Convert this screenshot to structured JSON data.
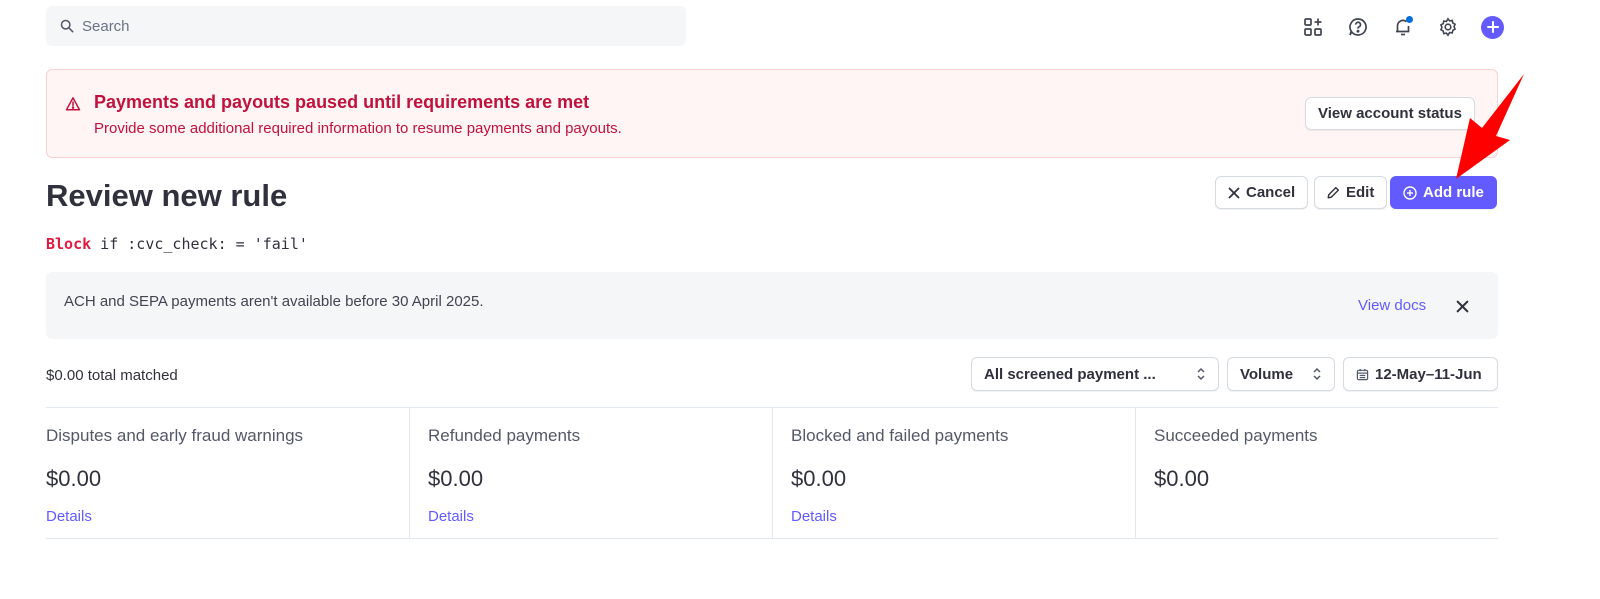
{
  "search": {
    "placeholder": "Search"
  },
  "top_icons": [
    "apps-icon",
    "help-icon",
    "bell-icon",
    "gear-icon",
    "plus-icon"
  ],
  "alert": {
    "title": "Payments and payouts paused until requirements are met",
    "description": "Provide some additional required information to resume payments and payouts.",
    "button_label": "View account status"
  },
  "header": {
    "title": "Review new rule",
    "cancel_label": "Cancel",
    "edit_label": "Edit",
    "add_label": "Add rule"
  },
  "rule": {
    "keyword": "Block",
    "condition": " if :cvc_check: = 'fail'"
  },
  "info": {
    "text": "ACH and SEPA payments aren't available before 30 April 2025.",
    "link_label": "View docs"
  },
  "filters": {
    "total": "$0.00 total matched",
    "payment_select": "All screened payment ...",
    "volume_select": "Volume",
    "date_range": "12-May–11-Jun"
  },
  "metrics": [
    {
      "label": "Disputes and early fraud warnings",
      "value": "$0.00",
      "link": "Details"
    },
    {
      "label": "Refunded payments",
      "value": "$0.00",
      "link": "Details"
    },
    {
      "label": "Blocked and failed payments",
      "value": "$0.00",
      "link": "Details"
    },
    {
      "label": "Succeeded payments",
      "value": "$0.00",
      "link": ""
    }
  ],
  "colors": {
    "accent": "#635bff",
    "alert_text": "#c0123c",
    "alert_bg": "#fff5f5",
    "annotation_arrow": "#ff0000"
  }
}
